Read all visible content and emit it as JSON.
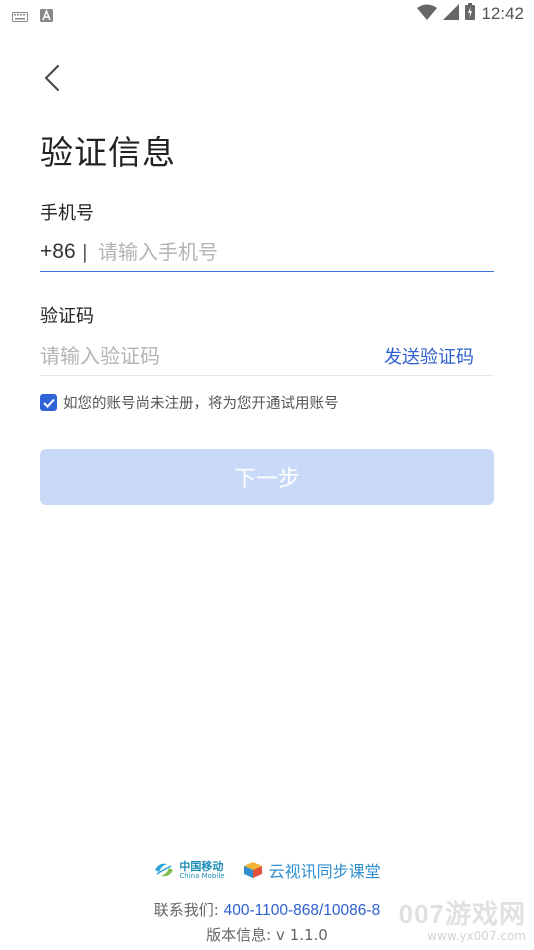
{
  "status_bar": {
    "time": "12:42",
    "icons": [
      "keyboard-icon",
      "a-notification-icon",
      "wifi-icon",
      "signal-icon",
      "battery-icon"
    ]
  },
  "page": {
    "title": "验证信息"
  },
  "phone": {
    "label": "手机号",
    "country_code": "+86",
    "separator": "|",
    "placeholder": "请输入手机号",
    "value": ""
  },
  "code": {
    "label": "验证码",
    "placeholder": "请输入验证码",
    "value": "",
    "send_label": "发送验证码"
  },
  "agreement": {
    "checked": true,
    "text": "如您的账号尚未注册，将为您开通试用账号"
  },
  "next_button": {
    "label": "下一步"
  },
  "footer": {
    "china_mobile_cn": "中国移动",
    "china_mobile_en": "China Mobile",
    "app_name": "云视讯同步课堂",
    "contact_label": "联系我们:",
    "contact_phone": "400-1100-868/10086-8",
    "version_label": "版本信息:",
    "version_value": "v 1.1.0"
  },
  "watermark": {
    "main": "007游戏网",
    "url": "www.yx007.com"
  },
  "colors": {
    "accent": "#2e5fcf",
    "checkbox": "#2f63d6",
    "button_disabled": "#c9daf8",
    "input_underline_active": "#3f6fd8"
  }
}
